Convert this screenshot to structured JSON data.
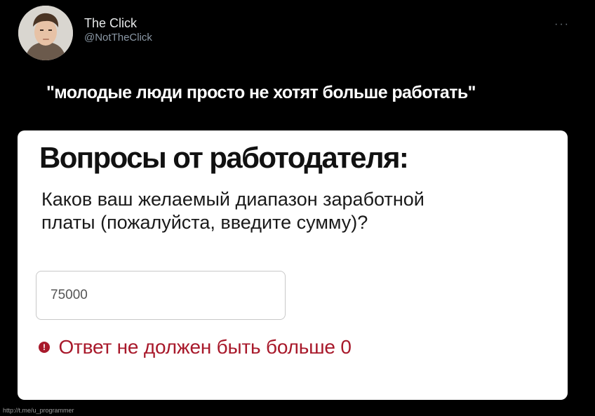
{
  "tweet": {
    "display_name": "The Click",
    "handle": "@NotTheClick",
    "text": "\"молодые люди просто не хотят больше работать\"",
    "more_icon": "more-dots-icon"
  },
  "card": {
    "title": "Вопросы от работодателя:",
    "question": "Каков ваш желаемый диапазон заработной платы (пожалуйста, введите сумму)?",
    "answer_value": "75000",
    "error_icon": "alert-circle-icon",
    "error_text": "Ответ не должен быть больше 0",
    "error_color": "#a8192b"
  },
  "watermark": "http://t.me/u_programmer"
}
